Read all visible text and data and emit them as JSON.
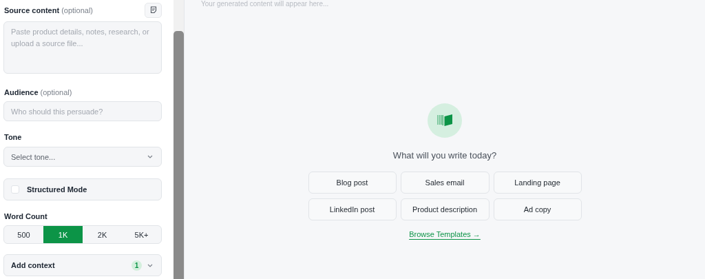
{
  "sidebar": {
    "source": {
      "label": "Source content",
      "hint": "(optional)",
      "placeholder": "Paste product details, notes, research, or upload a source file..."
    },
    "audience": {
      "label": "Audience",
      "hint": "(optional)",
      "placeholder": "Who should this persuade?"
    },
    "tone": {
      "label": "Tone",
      "placeholder": "Select tone..."
    },
    "structured_mode": {
      "label": "Structured Mode",
      "checked": false
    },
    "word_count": {
      "label": "Word Count",
      "options": [
        {
          "label": "500",
          "selected": false
        },
        {
          "label": "1K",
          "selected": true
        },
        {
          "label": "2K",
          "selected": false
        },
        {
          "label": "5K+",
          "selected": false
        }
      ]
    },
    "add_context": {
      "label": "Add context",
      "count": "1",
      "expanded": false
    }
  },
  "main": {
    "output_placeholder": "Your generated content will appear here...",
    "prompt": "What will you write today?",
    "templates": [
      "Blog post",
      "Sales email",
      "Landing page",
      "LinkedIn post",
      "Product description",
      "Ad copy"
    ],
    "browse_link": "Browse Templates →"
  }
}
